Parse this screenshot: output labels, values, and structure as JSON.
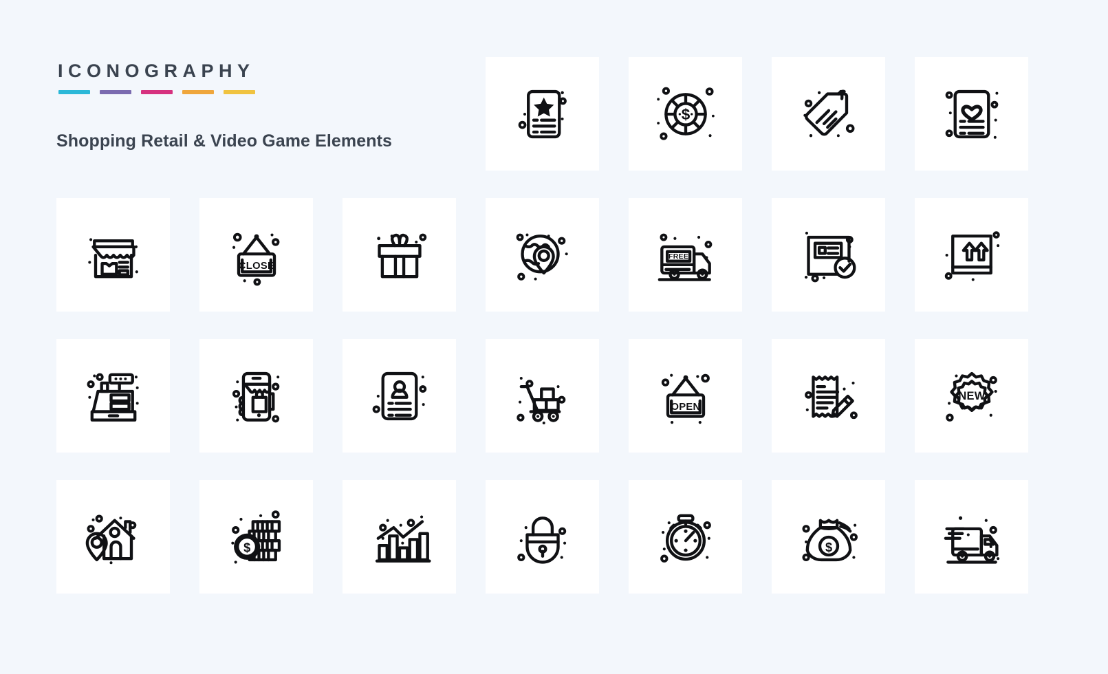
{
  "page": {
    "background_color": "#f3f7fc",
    "tile_color": "#ffffff",
    "icon_color": "#101114"
  },
  "header": {
    "brand_title": "ICONOGRAPHY",
    "subtitle": "Shopping Retail & Video Game Elements",
    "title_color": "#3a434f",
    "subtitle_color": "#3b4450",
    "rules": [
      {
        "name": "rule-cyan",
        "color": "#2bb8d8"
      },
      {
        "name": "rule-purple",
        "color": "#7b6bb0"
      },
      {
        "name": "rule-pink",
        "color": "#d6317f"
      },
      {
        "name": "rule-orange",
        "color": "#efa63c"
      },
      {
        "name": "rule-yellow",
        "color": "#f0c340"
      }
    ]
  },
  "grid": {
    "columns": 7,
    "rows": 4,
    "tiles": [
      {
        "slot": 1,
        "type": "placeholder",
        "icon": "",
        "label": ""
      },
      {
        "slot": 2,
        "type": "placeholder",
        "icon": "",
        "label": ""
      },
      {
        "slot": 3,
        "type": "placeholder",
        "icon": "",
        "label": ""
      },
      {
        "slot": 4,
        "type": "icon",
        "icon": "star-list-icon",
        "label": "Favorite List"
      },
      {
        "slot": 5,
        "type": "icon",
        "icon": "casino-chip-icon",
        "label": "Casino Chip"
      },
      {
        "slot": 6,
        "type": "icon",
        "icon": "price-tag-icon",
        "label": "Price Tag"
      },
      {
        "slot": 7,
        "type": "icon",
        "icon": "wishlist-heart-icon",
        "label": "Wishlist"
      },
      {
        "slot": 8,
        "type": "icon",
        "icon": "clothing-store-icon",
        "label": "Clothing Store"
      },
      {
        "slot": 9,
        "type": "icon",
        "icon": "close-sign-icon",
        "label": "Close Sign",
        "text": "CLOSE"
      },
      {
        "slot": 10,
        "type": "icon",
        "icon": "gift-box-icon",
        "label": "Gift Box"
      },
      {
        "slot": 11,
        "type": "icon",
        "icon": "global-location-icon",
        "label": "Global Location"
      },
      {
        "slot": 12,
        "type": "icon",
        "icon": "free-delivery-truck-icon",
        "label": "Free Delivery",
        "text": "FREE"
      },
      {
        "slot": 13,
        "type": "icon",
        "icon": "verified-card-icon",
        "label": "Verified Card"
      },
      {
        "slot": 14,
        "type": "icon",
        "icon": "this-side-up-box-icon",
        "label": "This Side Up"
      },
      {
        "slot": 15,
        "type": "icon",
        "icon": "cash-register-icon",
        "label": "Cash Register"
      },
      {
        "slot": 16,
        "type": "icon",
        "icon": "mobile-shopping-icon",
        "label": "Mobile Shopping"
      },
      {
        "slot": 17,
        "type": "icon",
        "icon": "id-card-icon",
        "label": "ID Card"
      },
      {
        "slot": 18,
        "type": "icon",
        "icon": "hand-truck-boxes-icon",
        "label": "Hand Truck"
      },
      {
        "slot": 19,
        "type": "icon",
        "icon": "open-sign-icon",
        "label": "Open Sign",
        "text": "OPEN"
      },
      {
        "slot": 20,
        "type": "icon",
        "icon": "receipt-pen-icon",
        "label": "Receipt Sign"
      },
      {
        "slot": 21,
        "type": "icon",
        "icon": "new-badge-icon",
        "label": "New Badge",
        "text": "NEW"
      },
      {
        "slot": 22,
        "type": "icon",
        "icon": "home-location-icon",
        "label": "Home Location"
      },
      {
        "slot": 23,
        "type": "icon",
        "icon": "coins-stack-icon",
        "label": "Coins Stack"
      },
      {
        "slot": 24,
        "type": "icon",
        "icon": "bar-chart-growth-icon",
        "label": "Growth Chart"
      },
      {
        "slot": 25,
        "type": "icon",
        "icon": "padlock-icon",
        "label": "Padlock"
      },
      {
        "slot": 26,
        "type": "icon",
        "icon": "stopwatch-icon",
        "label": "Stopwatch"
      },
      {
        "slot": 27,
        "type": "icon",
        "icon": "money-bag-icon",
        "label": "Money Bag"
      },
      {
        "slot": 28,
        "type": "icon",
        "icon": "fast-delivery-icon",
        "label": "Fast Delivery"
      }
    ],
    "icon_texts": {
      "close_sign": "CLOSE",
      "open_sign": "OPEN",
      "free_truck": "FREE",
      "new_badge": "NEW",
      "dollar": "$"
    }
  }
}
